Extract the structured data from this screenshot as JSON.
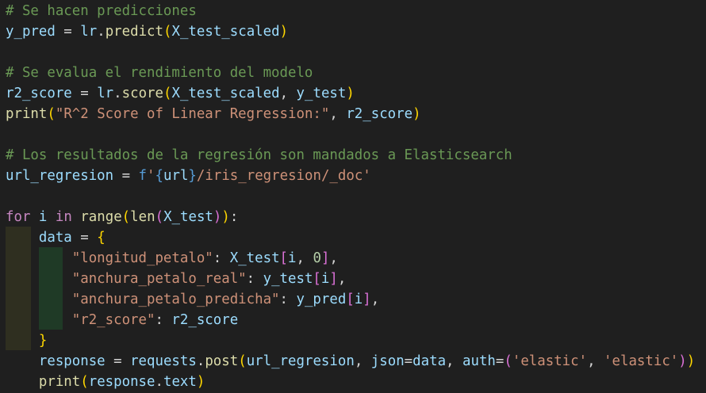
{
  "colors": {
    "background": "#1f1f1f",
    "comment": "#6a9955",
    "variable": "#9cdcfe",
    "function": "#dcdcaa",
    "string": "#ce9178",
    "keyword": "#c586c0",
    "builtin_keyword": "#569cd6",
    "number": "#b5cea8",
    "bracket_level1": "#ffd700",
    "bracket_level2": "#da70d6",
    "bracket_level3": "#179fff",
    "plain": "#d4d4d4"
  },
  "code": [
    [
      {
        "t": "# Se hacen predicciones",
        "c": "cm"
      }
    ],
    [
      {
        "t": "y_pred",
        "c": "va"
      },
      {
        "t": " = ",
        "c": "pl"
      },
      {
        "t": "lr",
        "c": "va"
      },
      {
        "t": ".",
        "c": "pl"
      },
      {
        "t": "predict",
        "c": "fn"
      },
      {
        "t": "(",
        "c": "b1"
      },
      {
        "t": "X_test_scaled",
        "c": "va"
      },
      {
        "t": ")",
        "c": "b1"
      }
    ],
    [],
    [
      {
        "t": "# Se evalua el rendimiento del modelo",
        "c": "cm"
      }
    ],
    [
      {
        "t": "r2_score",
        "c": "va"
      },
      {
        "t": " = ",
        "c": "pl"
      },
      {
        "t": "lr",
        "c": "va"
      },
      {
        "t": ".",
        "c": "pl"
      },
      {
        "t": "score",
        "c": "fn"
      },
      {
        "t": "(",
        "c": "b1"
      },
      {
        "t": "X_test_scaled",
        "c": "va"
      },
      {
        "t": ", ",
        "c": "pl"
      },
      {
        "t": "y_test",
        "c": "va"
      },
      {
        "t": ")",
        "c": "b1"
      }
    ],
    [
      {
        "t": "print",
        "c": "fn"
      },
      {
        "t": "(",
        "c": "b1"
      },
      {
        "t": "\"R^2 Score of Linear Regression:\"",
        "c": "st"
      },
      {
        "t": ", ",
        "c": "pl"
      },
      {
        "t": "r2_score",
        "c": "va"
      },
      {
        "t": ")",
        "c": "b1"
      }
    ],
    [],
    [
      {
        "t": "# Los resultados de la regresión son mandados a Elasticsearch",
        "c": "cm"
      }
    ],
    [
      {
        "t": "url_regresion",
        "c": "va"
      },
      {
        "t": " = ",
        "c": "pl"
      },
      {
        "t": "f",
        "c": "bl"
      },
      {
        "t": "'",
        "c": "st"
      },
      {
        "t": "{",
        "c": "bl"
      },
      {
        "t": "url",
        "c": "va"
      },
      {
        "t": "}",
        "c": "bl"
      },
      {
        "t": "/iris_regresion/_doc'",
        "c": "st"
      }
    ],
    [],
    [
      {
        "t": "for",
        "c": "kw"
      },
      {
        "t": " ",
        "c": "pl"
      },
      {
        "t": "i",
        "c": "va"
      },
      {
        "t": " ",
        "c": "pl"
      },
      {
        "t": "in",
        "c": "kw"
      },
      {
        "t": " ",
        "c": "pl"
      },
      {
        "t": "range",
        "c": "fn"
      },
      {
        "t": "(",
        "c": "b1"
      },
      {
        "t": "len",
        "c": "fn"
      },
      {
        "t": "(",
        "c": "b2"
      },
      {
        "t": "X_test",
        "c": "va"
      },
      {
        "t": ")",
        "c": "b2"
      },
      {
        "t": ")",
        "c": "b1"
      },
      {
        "t": ":",
        "c": "pl"
      }
    ],
    [
      {
        "t": "    ",
        "c": "pl"
      },
      {
        "t": "data",
        "c": "va"
      },
      {
        "t": " = ",
        "c": "pl"
      },
      {
        "t": "{",
        "c": "b1"
      }
    ],
    [
      {
        "t": "        ",
        "c": "pl"
      },
      {
        "t": "\"longitud_petalo\"",
        "c": "st"
      },
      {
        "t": ": ",
        "c": "pl"
      },
      {
        "t": "X_test",
        "c": "va"
      },
      {
        "t": "[",
        "c": "b2"
      },
      {
        "t": "i",
        "c": "va"
      },
      {
        "t": ", ",
        "c": "pl"
      },
      {
        "t": "0",
        "c": "nu"
      },
      {
        "t": "]",
        "c": "b2"
      },
      {
        "t": ",",
        "c": "pl"
      }
    ],
    [
      {
        "t": "        ",
        "c": "pl"
      },
      {
        "t": "\"anchura_petalo_real\"",
        "c": "st"
      },
      {
        "t": ": ",
        "c": "pl"
      },
      {
        "t": "y_test",
        "c": "va"
      },
      {
        "t": "[",
        "c": "b2"
      },
      {
        "t": "i",
        "c": "va"
      },
      {
        "t": "]",
        "c": "b2"
      },
      {
        "t": ",",
        "c": "pl"
      }
    ],
    [
      {
        "t": "        ",
        "c": "pl"
      },
      {
        "t": "\"anchura_petalo_predicha\"",
        "c": "st"
      },
      {
        "t": ": ",
        "c": "pl"
      },
      {
        "t": "y_pred",
        "c": "va"
      },
      {
        "t": "[",
        "c": "b2"
      },
      {
        "t": "i",
        "c": "va"
      },
      {
        "t": "]",
        "c": "b2"
      },
      {
        "t": ",",
        "c": "pl"
      }
    ],
    [
      {
        "t": "        ",
        "c": "pl"
      },
      {
        "t": "\"r2_score\"",
        "c": "st"
      },
      {
        "t": ": ",
        "c": "pl"
      },
      {
        "t": "r2_score",
        "c": "va"
      }
    ],
    [
      {
        "t": "    ",
        "c": "pl"
      },
      {
        "t": "}",
        "c": "b1"
      }
    ],
    [
      {
        "t": "    ",
        "c": "pl"
      },
      {
        "t": "response",
        "c": "va"
      },
      {
        "t": " = ",
        "c": "pl"
      },
      {
        "t": "requests",
        "c": "va"
      },
      {
        "t": ".",
        "c": "pl"
      },
      {
        "t": "post",
        "c": "fn"
      },
      {
        "t": "(",
        "c": "b1"
      },
      {
        "t": "url_regresion",
        "c": "va"
      },
      {
        "t": ", ",
        "c": "pl"
      },
      {
        "t": "json",
        "c": "va"
      },
      {
        "t": "=",
        "c": "pl"
      },
      {
        "t": "data",
        "c": "va"
      },
      {
        "t": ", ",
        "c": "pl"
      },
      {
        "t": "auth",
        "c": "va"
      },
      {
        "t": "=",
        "c": "pl"
      },
      {
        "t": "(",
        "c": "b2"
      },
      {
        "t": "'elastic'",
        "c": "st"
      },
      {
        "t": ", ",
        "c": "pl"
      },
      {
        "t": "'elastic'",
        "c": "st"
      },
      {
        "t": ")",
        "c": "b2"
      },
      {
        "t": ")",
        "c": "b1"
      }
    ],
    [
      {
        "t": "    ",
        "c": "pl"
      },
      {
        "t": "print",
        "c": "fn"
      },
      {
        "t": "(",
        "c": "b1"
      },
      {
        "t": "response",
        "c": "va"
      },
      {
        "t": ".",
        "c": "pl"
      },
      {
        "t": "text",
        "c": "va"
      },
      {
        "t": ")",
        "c": "b1"
      }
    ]
  ]
}
